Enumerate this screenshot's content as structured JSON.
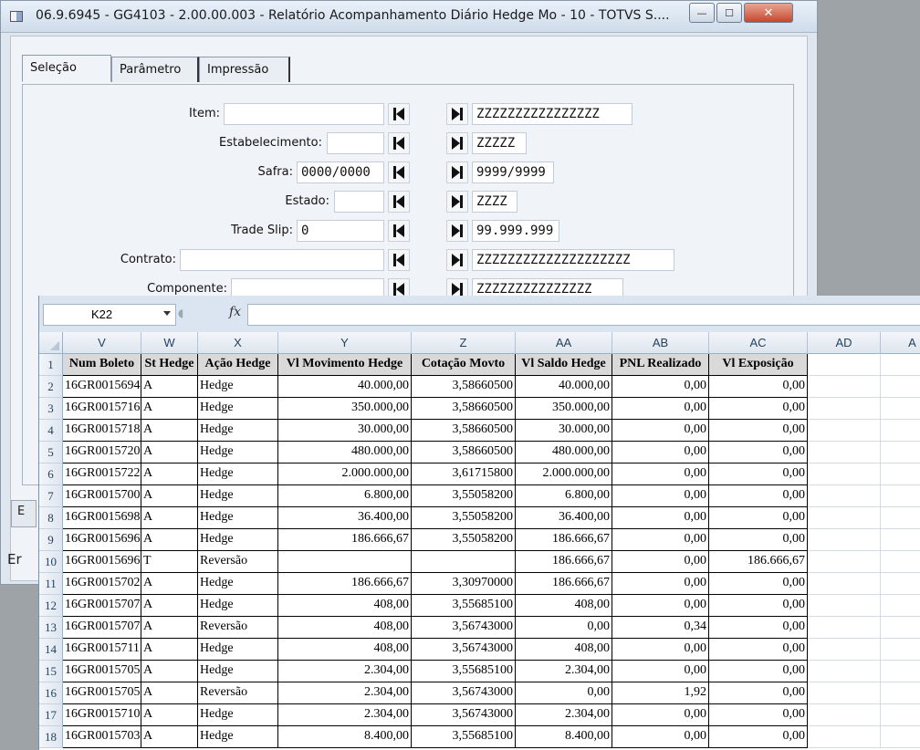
{
  "window": {
    "title": "06.9.6945 - GG4103 - 2.00.00.003 - Relatório Acompanhamento Diário Hedge Mo - 10 - TOTVS S....",
    "minimize_glyph": "—",
    "maximize_glyph": "☐",
    "close_glyph": "✕"
  },
  "tabs": [
    {
      "label": "Seleção"
    },
    {
      "label": "Parâmetro"
    },
    {
      "label": "Impressão"
    }
  ],
  "form": {
    "fields": [
      {
        "label": "Item:",
        "from": "",
        "to": "ZZZZZZZZZZZZZZZZ"
      },
      {
        "label": "Estabelecimento:",
        "from": "",
        "to": "ZZZZZ"
      },
      {
        "label": "Safra:",
        "from": "0000/0000",
        "to": "9999/9999"
      },
      {
        "label": "Estado:",
        "from": "",
        "to": "ZZZZ"
      },
      {
        "label": "Trade Slip:",
        "from": "0",
        "to": "99.999.999"
      },
      {
        "label": "Contrato:",
        "from": "",
        "to": "ZZZZZZZZZZZZZZZZZZZZ"
      },
      {
        "label": "Componente:",
        "from": "",
        "to": "ZZZZZZZZZZZZZZZ"
      }
    ],
    "nav_first_icon": "first-icon",
    "nav_last_icon": "last-icon"
  },
  "bottom_buttons": [
    {
      "label": "E"
    },
    {
      "label": "Er"
    }
  ],
  "excel": {
    "name_box": "K22",
    "fx_label": "fx",
    "formula": "",
    "columns": [
      "V",
      "W",
      "X",
      "Y",
      "Z",
      "AA",
      "AB",
      "AC",
      "AD",
      "A"
    ],
    "headers": [
      "Num Boleto",
      "St Hedge",
      "Ação Hedge",
      "Vl Movimento Hedge",
      "Cotação Movto",
      "Vl Saldo Hedge",
      "PNL Realizado",
      "Vl Exposição"
    ],
    "rows": [
      {
        "n": "1"
      },
      {
        "n": "2",
        "cells": [
          "16GR0015694",
          "A",
          "Hedge",
          "40.000,00",
          "3,58660500",
          "40.000,00",
          "0,00",
          "0,00"
        ]
      },
      {
        "n": "3",
        "cells": [
          "16GR0015716",
          "A",
          "Hedge",
          "350.000,00",
          "3,58660500",
          "350.000,00",
          "0,00",
          "0,00"
        ]
      },
      {
        "n": "4",
        "cells": [
          "16GR0015718",
          "A",
          "Hedge",
          "30.000,00",
          "3,58660500",
          "30.000,00",
          "0,00",
          "0,00"
        ]
      },
      {
        "n": "5",
        "cells": [
          "16GR0015720",
          "A",
          "Hedge",
          "480.000,00",
          "3,58660500",
          "480.000,00",
          "0,00",
          "0,00"
        ]
      },
      {
        "n": "6",
        "cells": [
          "16GR0015722",
          "A",
          "Hedge",
          "2.000.000,00",
          "3,61715800",
          "2.000.000,00",
          "0,00",
          "0,00"
        ]
      },
      {
        "n": "7",
        "cells": [
          "16GR0015700",
          "A",
          "Hedge",
          "6.800,00",
          "3,55058200",
          "6.800,00",
          "0,00",
          "0,00"
        ]
      },
      {
        "n": "8",
        "cells": [
          "16GR0015698",
          "A",
          "Hedge",
          "36.400,00",
          "3,55058200",
          "36.400,00",
          "0,00",
          "0,00"
        ]
      },
      {
        "n": "9",
        "cells": [
          "16GR0015696",
          "A",
          "Hedge",
          "186.666,67",
          "3,55058200",
          "186.666,67",
          "0,00",
          "0,00"
        ]
      },
      {
        "n": "10",
        "cells": [
          "16GR0015696",
          "T",
          "Reversão",
          "",
          "",
          "186.666,67",
          "0,00",
          "186.666,67"
        ]
      },
      {
        "n": "11",
        "cells": [
          "16GR0015702",
          "A",
          "Hedge",
          "186.666,67",
          "3,30970000",
          "186.666,67",
          "0,00",
          "0,00"
        ]
      },
      {
        "n": "12",
        "cells": [
          "16GR0015707",
          "A",
          "Hedge",
          "408,00",
          "3,55685100",
          "408,00",
          "0,00",
          "0,00"
        ]
      },
      {
        "n": "13",
        "cells": [
          "16GR0015707",
          "A",
          "Reversão",
          "408,00",
          "3,56743000",
          "0,00",
          "0,34",
          "0,00"
        ]
      },
      {
        "n": "14",
        "cells": [
          "16GR0015711",
          "A",
          "Hedge",
          "408,00",
          "3,56743000",
          "408,00",
          "0,00",
          "0,00"
        ]
      },
      {
        "n": "15",
        "cells": [
          "16GR0015705",
          "A",
          "Hedge",
          "2.304,00",
          "3,55685100",
          "2.304,00",
          "0,00",
          "0,00"
        ]
      },
      {
        "n": "16",
        "cells": [
          "16GR0015705",
          "A",
          "Reversão",
          "2.304,00",
          "3,56743000",
          "0,00",
          "1,92",
          "0,00"
        ]
      },
      {
        "n": "17",
        "cells": [
          "16GR0015710",
          "A",
          "Hedge",
          "2.304,00",
          "3,56743000",
          "2.304,00",
          "0,00",
          "0,00"
        ]
      },
      {
        "n": "18",
        "cells": [
          "16GR0015703",
          "A",
          "Hedge",
          "8.400,00",
          "3,55685100",
          "8.400,00",
          "0,00",
          "0,00"
        ]
      }
    ]
  }
}
